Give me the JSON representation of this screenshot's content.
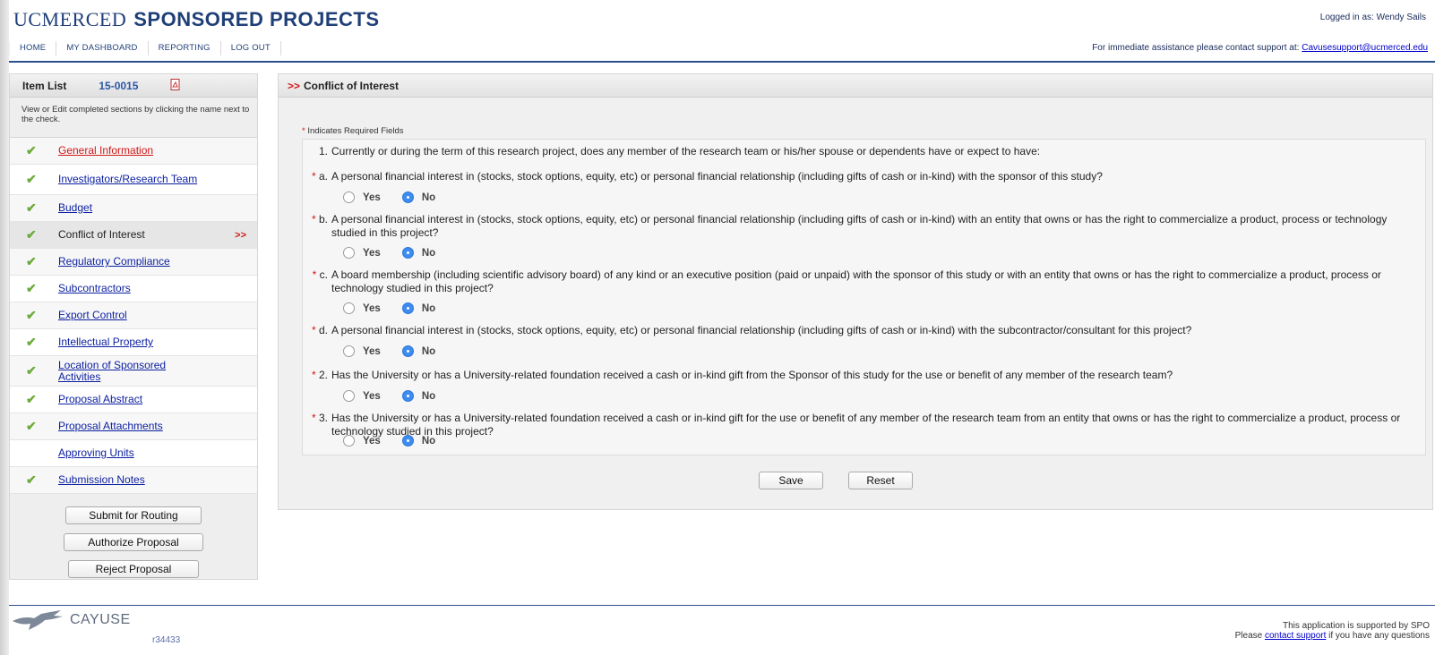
{
  "header": {
    "brand_uc": "UCMERCED",
    "brand_title": "SPONSORED PROJECTS",
    "logged_in": "Logged in as: Wendy Sails",
    "nav": [
      "HOME",
      "MY DASHBOARD",
      "REPORTING",
      "LOG OUT"
    ],
    "assist_text": "For immediate assistance please contact support at: ",
    "assist_email": "Cavusesupport@ucmerced.edu"
  },
  "sidebar": {
    "title": "Item List",
    "number": "15-0015",
    "description": "View or Edit completed sections by clicking the name next to the check.",
    "items": [
      {
        "label": "General Information",
        "checked": true
      },
      {
        "label": "Investigators/Research Team",
        "checked": true
      },
      {
        "label": "Budget",
        "checked": true
      },
      {
        "label": "Conflict of Interest",
        "checked": true,
        "active": true,
        "arrow": ">>"
      },
      {
        "label": "Regulatory Compliance",
        "checked": true
      },
      {
        "label": "Subcontractors",
        "checked": true
      },
      {
        "label": "Export Control",
        "checked": true
      },
      {
        "label": "Intellectual Property",
        "checked": true
      },
      {
        "label": "Location of Sponsored Activities",
        "checked": true
      },
      {
        "label": "Proposal Abstract",
        "checked": true
      },
      {
        "label": "Proposal Attachments",
        "checked": true
      },
      {
        "label": "Approving Units",
        "checked": false
      },
      {
        "label": "Submission Notes",
        "checked": true
      }
    ],
    "buttons": [
      "Submit for Routing",
      "Authorize Proposal",
      "Reject Proposal"
    ]
  },
  "main": {
    "title_prefix": ">>",
    "title": "Conflict of Interest",
    "required_star": "*",
    "required_note": "Indicates Required Fields",
    "questions": [
      {
        "label": "1.",
        "required": false,
        "text": "Currently or during the term of this research project, does any member of the research team or his/her spouse or dependents have or expect to have:",
        "has_radio": false
      },
      {
        "label": "a.",
        "required": true,
        "text": "A personal financial interest in (stocks, stock options, equity, etc) or personal financial relationship (including gifts of cash or in-kind) with the sponsor of this study?",
        "has_radio": true,
        "answer": "No"
      },
      {
        "label": "b.",
        "required": true,
        "text": "A personal financial interest in (stocks, stock options, equity, etc) or personal financial relationship (including gifts of cash or in-kind) with an entity that owns or has the right to commercialize a product, process or technology studied in this project?",
        "has_radio": true,
        "answer": "No"
      },
      {
        "label": "c.",
        "required": true,
        "text": "A board membership (including scientific advisory board) of any kind or an executive position (paid or unpaid) with the sponsor of this study or with an entity that owns or has the right to commercialize a product, process or technology studied in this project?",
        "has_radio": true,
        "answer": "No"
      },
      {
        "label": "d.",
        "required": true,
        "text": "A personal financial interest in (stocks, stock options, equity, etc) or personal financial relationship (including gifts of cash or in-kind) with the subcontractor/consultant for this project?",
        "has_radio": true,
        "answer": "No"
      },
      {
        "label": "2.",
        "required": true,
        "text": "Has the University or has a University-related foundation received a cash or in-kind gift from the Sponsor of this study for the use or benefit of any member of the research team?",
        "has_radio": true,
        "answer": "No"
      },
      {
        "label": "3.",
        "required": true,
        "text": "Has the University or has a University-related foundation received a cash or in-kind gift for the use or benefit of any member of the research team from an entity that owns or has the right to commercialize a product, process or technology studied in this project?",
        "has_radio": true,
        "answer": "No"
      }
    ],
    "yes_label": "Yes",
    "no_label": "No",
    "save_label": "Save",
    "reset_label": "Reset"
  },
  "footer": {
    "logo_text": "CAYUSE",
    "version": "r34433",
    "support_line1": "This application is supported by SPO",
    "support_pre": "Please ",
    "support_link": "contact support",
    "support_post": " if you have any questions"
  },
  "colors": {
    "brand": "#1f3f78",
    "link": "#0b1fa0",
    "required": "#d01818",
    "check": "#6cab3c",
    "radio_selected": "#3d8cf0"
  }
}
